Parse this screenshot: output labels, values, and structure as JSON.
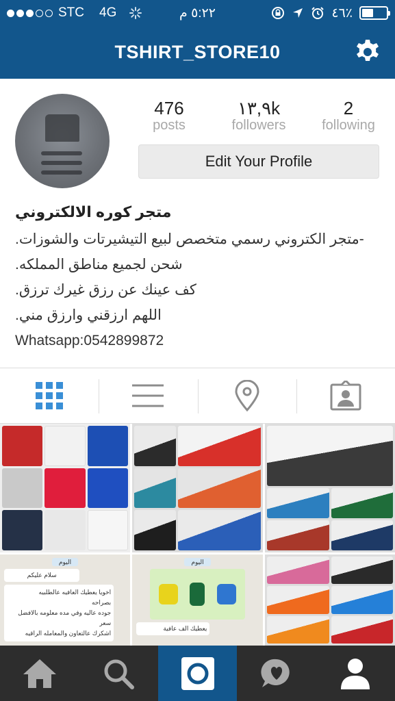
{
  "status_bar": {
    "carrier": "STC",
    "network": "4G",
    "time": "٥:٢٢ م",
    "battery_percent": "٤٦٪",
    "battery_level": 0.46
  },
  "nav": {
    "title": "TSHIRT_STORE10",
    "settings_icon": "gear-icon"
  },
  "profile": {
    "stats": [
      {
        "value": "476",
        "label": "posts"
      },
      {
        "value": "١٣,٩k",
        "label": "followers"
      },
      {
        "value": "2",
        "label": "following"
      }
    ],
    "edit_button": "Edit Your Profile",
    "name": "متجر كوره الالكتروني",
    "bio_lines": [
      "-متجر الكتروني رسمي متخصص لبيع التيشيرتات والشوزات.",
      "شحن لجميع مناطق المملكه.",
      "كف عينك عن رزق غيرك ترزق.",
      "اللهم ارزقني وارزق مني.",
      "Whatsapp:0542899872"
    ]
  },
  "view_tabs": [
    {
      "name": "grid-view",
      "icon": "grid-icon",
      "active": true
    },
    {
      "name": "list-view",
      "icon": "list-icon",
      "active": false
    },
    {
      "name": "places-view",
      "icon": "location-pin-icon",
      "active": false
    },
    {
      "name": "tagged-view",
      "icon": "tagged-photo-icon",
      "active": false
    }
  ],
  "grid_posts": {
    "chat_post_1": {
      "header": "اليوم",
      "greeting": "سلام عليكم",
      "message_lines": [
        "اخويا يعطيك العافيه عالطلبيه",
        "بصراحه",
        "جوده عاليه وفي مده معلومه بالافضل سعر",
        "اشكرك عالتعاون والمعامله الراقيه"
      ]
    },
    "chat_post_2": {
      "header": "اليوم",
      "reply": "يعطيك الف عافية"
    }
  },
  "colors": {
    "brand": "#12568c",
    "tabbar": "#2d2d2d",
    "active_tab_icon": "#3a8fd6"
  },
  "bottom_tabs": [
    {
      "name": "home",
      "icon": "home-icon",
      "active": false
    },
    {
      "name": "search",
      "icon": "search-icon",
      "active": false
    },
    {
      "name": "camera",
      "icon": "camera-icon",
      "active": true
    },
    {
      "name": "activity",
      "icon": "heart-bubble-icon",
      "active": false
    },
    {
      "name": "profile",
      "icon": "profile-icon",
      "active": false
    }
  ]
}
